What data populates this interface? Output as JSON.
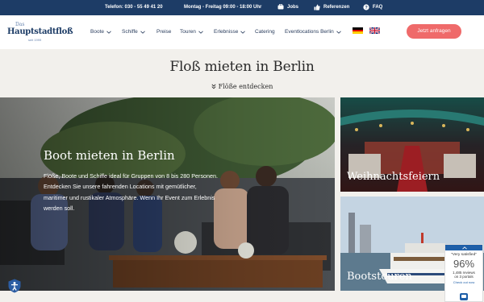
{
  "topbar": {
    "phone": "Telefon: 030 - 55 49 41 20",
    "hours": "Montag - Freitag 09:00 - 18:00 Uhr",
    "jobs": "Jobs",
    "references": "Referenzen",
    "faq": "FAQ"
  },
  "logo": {
    "line1": "Das",
    "line2": "Hauptstadtfloß",
    "line3": "seit 1999"
  },
  "nav": {
    "items": [
      "Boote",
      "Schiffe",
      "Preise",
      "Touren",
      "Erlebnisse",
      "Catering",
      "Eventlocations Berlin"
    ],
    "cta": "Jetzt anfragen"
  },
  "main": {
    "title": "Floß mieten in Berlin",
    "subtitle": "Flöße entdecken"
  },
  "hero": {
    "title": "Boot mieten in Berlin",
    "text": "Flöße, Boote und Schiffe ideal für Gruppen von 8 bis 280 Personen. Entdecken Sie unsere fahrenden Locations mit gemütlicher, maritimer und rustikaler Atmosphäre. Wenn Ihr Event zum Erlebnis werden soll."
  },
  "cards": [
    {
      "title": "Weihnachtsfeiern"
    },
    {
      "title": "Bootstouren"
    }
  ],
  "review_badge": {
    "label": "\"Very satisfied\"",
    "percent": "96%",
    "count": "1,485 reviews",
    "portals": "on 3 portals",
    "link": "Check out now"
  },
  "colors": {
    "topbar": "#1d3c66",
    "cta": "#ef6a6a",
    "page_bg": "#f2f0ec",
    "badge_accent": "#1f5fa8"
  }
}
